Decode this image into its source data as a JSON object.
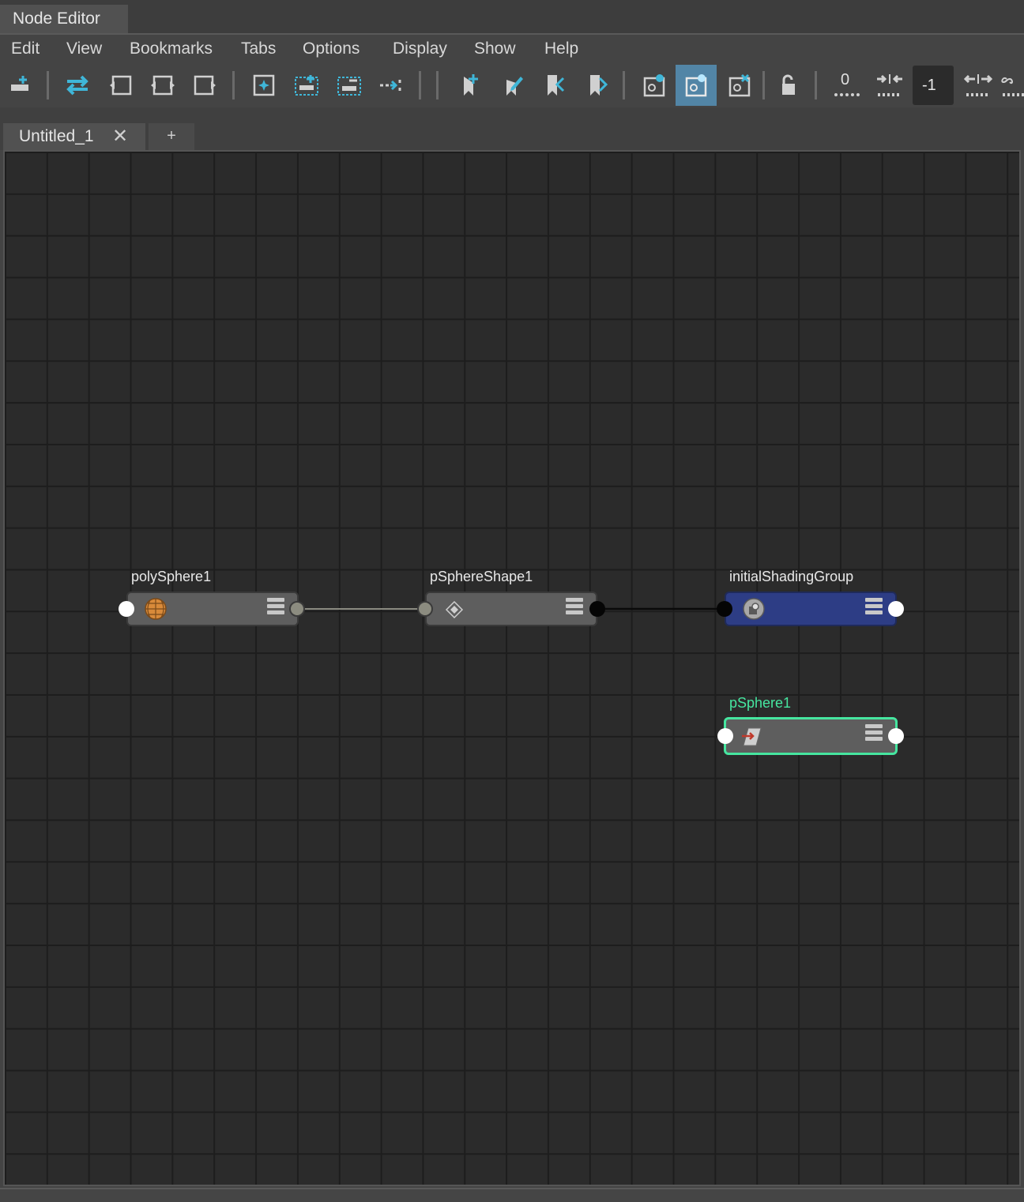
{
  "window": {
    "title": "Node Editor"
  },
  "menu": {
    "items": [
      "Edit",
      "View",
      "Bookmarks",
      "Tabs",
      "Options",
      "Display",
      "Show",
      "Help"
    ]
  },
  "toolbar": {
    "icons": [
      "add-node-icon",
      "swap-icon",
      "input-connections-icon",
      "input-output-connections-icon",
      "output-connections-icon",
      "frame-selection-icon",
      "add-selected-icon",
      "remove-selected-icon",
      "layout-icon",
      "bookmark-add-icon",
      "bookmark-edit-icon",
      "bookmark-previous-icon",
      "bookmark-next-icon",
      "graph-icon",
      "graph-active-icon",
      "graph-clear-icon",
      "lock-icon",
      "collapse-icon",
      "expand-icon",
      "spread-icon",
      "infinity-icon"
    ],
    "collapse_label": "0",
    "depth_value": "-1",
    "active_icon": "graph-active-icon"
  },
  "tabs": {
    "items": [
      {
        "label": "Untitled_1",
        "closable": true
      }
    ],
    "add_label": "+",
    "close_glyph": "✕"
  },
  "graph": {
    "nodes": [
      {
        "label": "polySphere1",
        "icon": "poly-sphere-icon",
        "style": "default"
      },
      {
        "label": "pSphereShape1",
        "icon": "mesh-shape-icon",
        "style": "default"
      },
      {
        "label": "initialShadingGroup",
        "icon": "shading-group-icon",
        "style": "shading",
        "color": "#2d3d85"
      },
      {
        "label": "pSphere1",
        "icon": "transform-icon",
        "style": "selected",
        "color": "#46e6a0"
      }
    ],
    "connections": [
      {
        "from": "polySphere1",
        "to": "pSphereShape1"
      },
      {
        "from": "pSphereShape1",
        "to": "initialShadingGroup"
      }
    ]
  }
}
